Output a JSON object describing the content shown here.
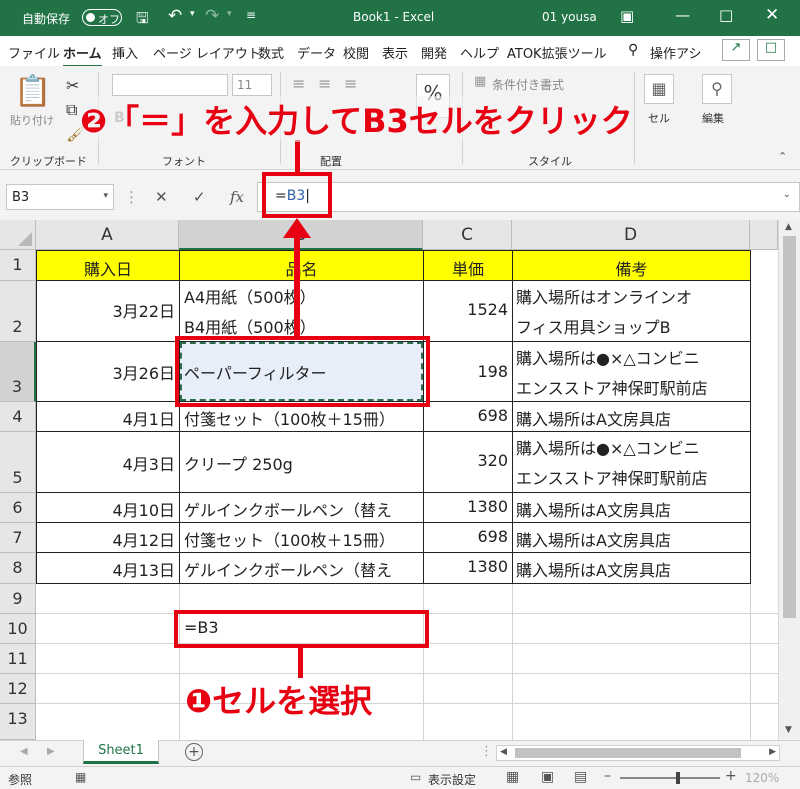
{
  "window": {
    "autosave_label": "自動保存",
    "autosave_state": "オフ",
    "title": "Book1 - Excel",
    "user": "01 yousa"
  },
  "menu": {
    "tabs": [
      "ファイル",
      "ホーム",
      "挿入",
      "ページ レイアウト",
      "数式",
      "データ",
      "校閲",
      "表示",
      "開発",
      "ヘルプ",
      "ATOK拡張ツール",
      "操作アシ"
    ],
    "active": "ホーム"
  },
  "ribbon": {
    "paste_label": "貼り付け",
    "font_size": "11",
    "conditional_format_label": "条件付き書式",
    "group_labels": [
      "クリップボード",
      "フォント",
      "配置",
      "スタイル"
    ],
    "cell_label": "セル",
    "edit_label": "編集"
  },
  "formula_bar": {
    "name_box": "B3",
    "fx": "fx",
    "formula_prefix": "=",
    "formula_ref": "B3"
  },
  "grid": {
    "columns": [
      "A",
      "B",
      "C",
      "D"
    ],
    "rows": [
      "1",
      "2",
      "3",
      "4",
      "5",
      "6",
      "7",
      "8",
      "9",
      "10",
      "11",
      "12",
      "13"
    ],
    "header": [
      "購入日",
      "品名",
      "単価",
      "備考"
    ],
    "data": [
      {
        "date": "3月22日",
        "item_lines": [
          "A4用紙（500枚）",
          "B4用紙（500枚）"
        ],
        "price": "1524",
        "note_lines": [
          "購入場所はオンラインオ",
          "フィス用具ショップB"
        ]
      },
      {
        "date": "3月26日",
        "item_lines": [
          "ペーパーフィルター"
        ],
        "price": "198",
        "note_lines": [
          "購入場所は●×△コンビニ",
          "エンスストア神保町駅前店"
        ]
      },
      {
        "date": "4月1日",
        "item_lines": [
          "付箋セット（100枚＋15冊）"
        ],
        "price": "698",
        "note_lines": [
          "購入場所はA文房具店"
        ]
      },
      {
        "date": "4月3日",
        "item_lines": [
          "クリープ 250g"
        ],
        "price": "320",
        "note_lines": [
          "購入場所は●×△コンビニ",
          "エンスストア神保町駅前店"
        ]
      },
      {
        "date": "4月10日",
        "item_lines": [
          "ゲルインクボールペン（替え"
        ],
        "price": "1380",
        "note_lines": [
          "購入場所はA文房具店"
        ]
      },
      {
        "date": "4月12日",
        "item_lines": [
          "付箋セット（100枚＋15冊）"
        ],
        "price": "698",
        "note_lines": [
          "購入場所はA文房具店"
        ]
      },
      {
        "date": "4月13日",
        "item_lines": [
          "ゲルインクボールペン（替え"
        ],
        "price": "1380",
        "note_lines": [
          "購入場所はA文房具店"
        ]
      }
    ],
    "b10_value": "=B3"
  },
  "annotations": {
    "step2": "❷「＝」を入力してB3セルをクリック",
    "step1": "❶セルを選択"
  },
  "sheet": {
    "tab": "Sheet1"
  },
  "status": {
    "mode": "参照",
    "display_settings": "表示設定",
    "zoom": "120%"
  },
  "colors": {
    "excel_green": "#217346",
    "header_yellow": "#ffff00",
    "annotation_red": "#e60012",
    "copy_blue": "#2f5fa8"
  }
}
